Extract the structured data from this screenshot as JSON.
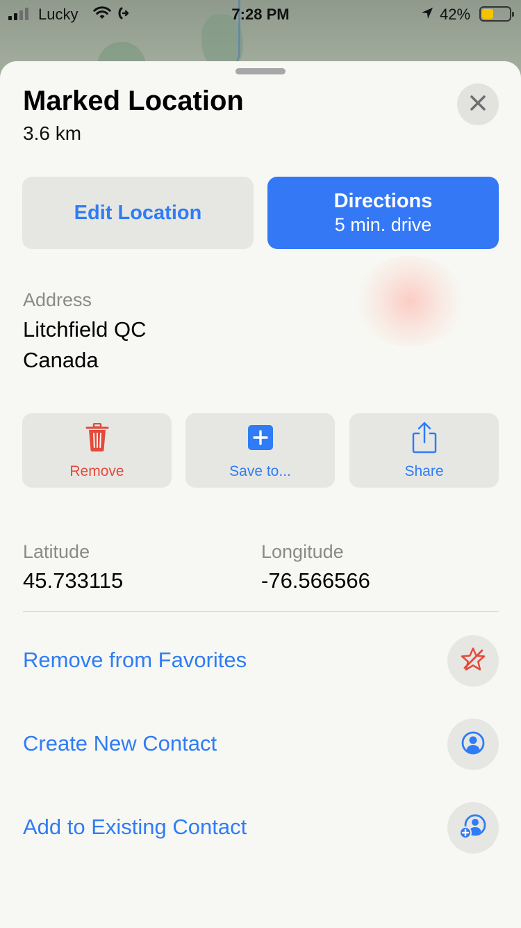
{
  "status_bar": {
    "carrier": "Lucky",
    "time": "7:28 PM",
    "battery_percent": "42%",
    "battery_level": 0.42,
    "battery_color": "#f5c400",
    "icons": [
      "signal-icon",
      "wifi-icon",
      "call-forwarding-icon",
      "location-arrow-icon",
      "battery-icon"
    ]
  },
  "sheet": {
    "title": "Marked Location",
    "distance": "3.6 km",
    "close_icon": "close-icon"
  },
  "primary_actions": {
    "edit_label": "Edit Location",
    "directions_label": "Directions",
    "directions_sub": "5 min. drive"
  },
  "address": {
    "label": "Address",
    "line1": "Litchfield QC",
    "line2": "Canada"
  },
  "quick_actions": [
    {
      "label": "Remove",
      "icon": "trash-icon",
      "color": "#e34b3c"
    },
    {
      "label": "Save to...",
      "icon": "plus-square-icon",
      "color": "#2f7cf6"
    },
    {
      "label": "Share",
      "icon": "share-icon",
      "color": "#2f7cf6"
    }
  ],
  "coordinates": {
    "latitude_label": "Latitude",
    "latitude": "45.733115",
    "longitude_label": "Longitude",
    "longitude": "-76.566566"
  },
  "links": [
    {
      "label": "Remove from Favorites",
      "icon": "star-remove-icon"
    },
    {
      "label": "Create New Contact",
      "icon": "person-circle-icon"
    },
    {
      "label": "Add to Existing Contact",
      "icon": "person-add-icon"
    }
  ],
  "colors": {
    "accent": "#2f7cf6",
    "directions_bg": "#3478f6",
    "destructive": "#e34b3c"
  }
}
